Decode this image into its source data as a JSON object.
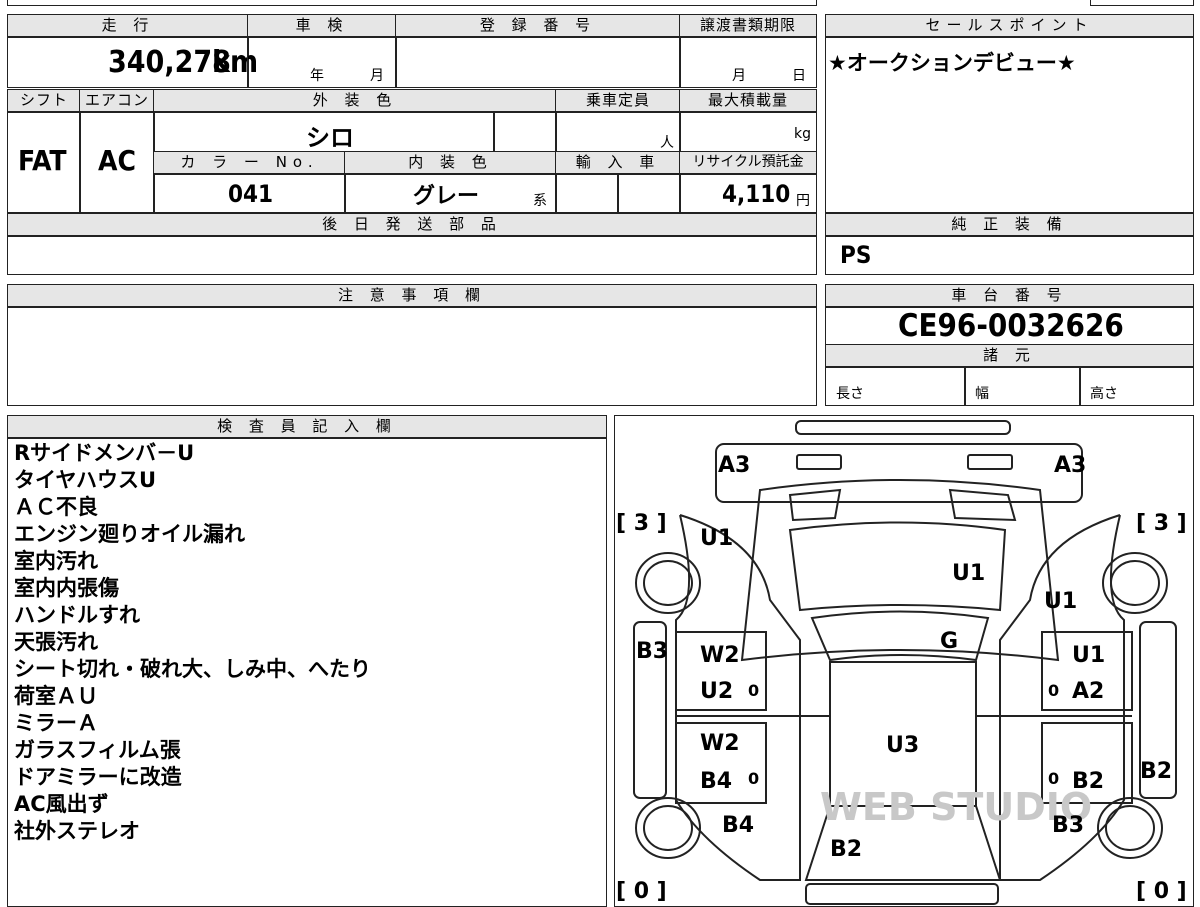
{
  "headers": {
    "mileage": "走 行",
    "shaken": "車 検",
    "reg_no": "登 録 番 号",
    "transfer_deadline": "譲渡書類期限",
    "sales_point": "セールスポイント",
    "shift": "シフト",
    "aircon": "エアコン",
    "exterior_color": "外 装 色",
    "capacity": "乗車定員",
    "max_load": "最大積載量",
    "color_no": "カ ラ ー No.",
    "interior_color": "内 装 色",
    "import": "輸 入 車",
    "recycle_fee": "リサイクル預託金",
    "later_parts": "後 日 発 送 部 品",
    "genuine_equip": "純 正 装 備",
    "notes": "注 意 事 項 欄",
    "chassis_no": "車 台 番 号",
    "specs": "諸 元",
    "inspector": "検 査 員 記 入 欄"
  },
  "values": {
    "mileage": "340,278",
    "mileage_unit": "km",
    "shaken_year_unit": "年",
    "shaken_month_unit": "月",
    "transfer_month_unit": "月",
    "transfer_day_unit": "日",
    "sales_point_text": "★オークションデビュー★",
    "shift": "FAT",
    "aircon": "AC",
    "exterior_color": "シロ",
    "capacity_unit": "人",
    "max_load_unit": "kg",
    "color_no": "041",
    "interior_color": "グレー",
    "interior_color_suffix": "系",
    "recycle_fee": "4,110",
    "recycle_fee_unit": "円",
    "genuine_equip": "PS",
    "chassis_no": "CE96-0032626",
    "length_label": "長さ",
    "width_label": "幅",
    "height_label": "高さ"
  },
  "inspector_notes": [
    "Rサイドメンバ－U",
    "タイヤハウスU",
    "ＡＣ不良",
    "エンジン廻りオイル漏れ",
    "室内汚れ",
    "室内内張傷",
    "ハンドルすれ",
    "天張汚れ",
    "シート切れ・破れ大、しみ中、へたり",
    "荷室ＡＵ",
    "ミラーＡ",
    "ガラスフィルム張",
    "ドアミラーに改造",
    "AC風出ず",
    "社外ステレオ"
  ],
  "diagram": {
    "labels": {
      "a3_left": "A3",
      "a3_right": "A3",
      "tire_fl": "[ 3 ]",
      "tire_fr": "[ 3 ]",
      "tire_rl": "[ 0 ]",
      "tire_rr": "[ 0 ]",
      "u1_fl": "U1",
      "u1_hood": "U1",
      "u1_fr": "U1",
      "u1_rf_door": "U1",
      "g_windshield": "G",
      "b3_left": "B3",
      "w2_lf": "W2",
      "u2_lf": "U2",
      "a2_rf": "A2",
      "w2_lr": "W2",
      "b4_lr": "B4",
      "u3_roof": "U3",
      "b2_rr": "B2",
      "b2_right": "B2",
      "b4_rear": "B4",
      "b3_rear": "B3",
      "b2_back": "B2",
      "zero_1": "0",
      "zero_2": "0",
      "zero_3": "0",
      "zero_4": "0"
    },
    "watermark": "WEB STUDIO"
  }
}
